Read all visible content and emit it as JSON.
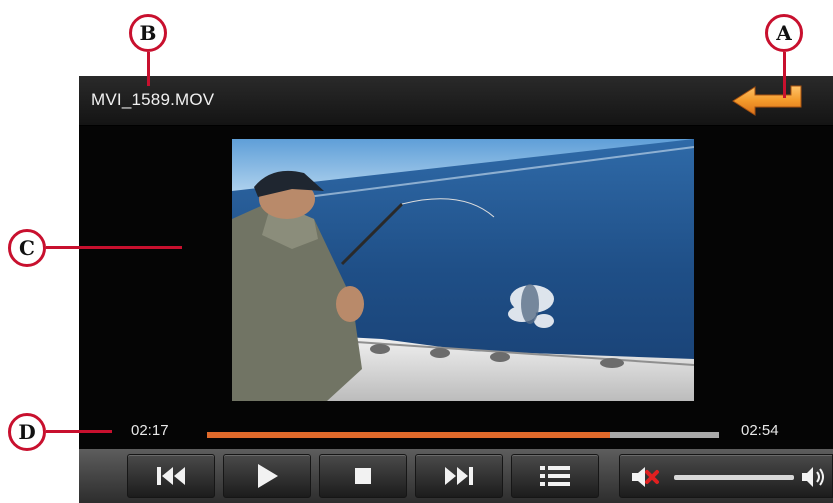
{
  "callouts": {
    "a": "A",
    "b": "B",
    "c": "C",
    "d": "D"
  },
  "titlebar": {
    "filename": "MVI_1589.MOV",
    "back_icon": "back-arrow-icon"
  },
  "playback": {
    "current_time": "02:17",
    "total_time": "02:54",
    "progress_fraction": 0.787,
    "volume_level": 0.0,
    "muted": true
  },
  "controls": {
    "previous_icon": "skip-previous-icon",
    "play_icon": "play-icon",
    "stop_icon": "stop-icon",
    "next_icon": "skip-next-icon",
    "playlist_icon": "list-icon",
    "mute_icon": "speaker-muted-icon",
    "volume_max_icon": "speaker-loud-icon"
  },
  "colors": {
    "accent": "#e06a2b",
    "callout": "#c8102e",
    "player_bg": "#060606"
  }
}
